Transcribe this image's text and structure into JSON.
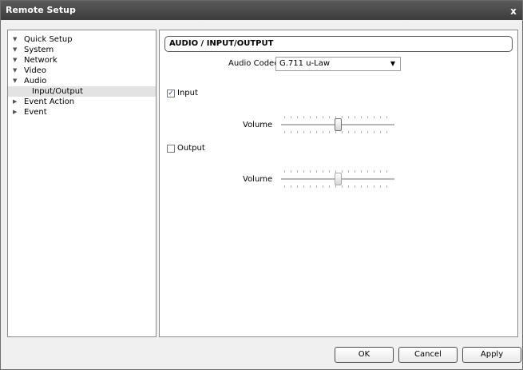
{
  "window": {
    "title": "Remote Setup",
    "close_glyph": "x",
    "close_icon": "close-icon"
  },
  "tree": {
    "items": [
      {
        "label": "Quick Setup",
        "expanded": true
      },
      {
        "label": "System",
        "expanded": true
      },
      {
        "label": "Network",
        "expanded": true
      },
      {
        "label": "Video",
        "expanded": true
      },
      {
        "label": "Audio",
        "expanded": true
      },
      {
        "label": "Input/Output",
        "selected": true
      },
      {
        "label": "Event Action",
        "expanded": false
      },
      {
        "label": "Event",
        "expanded": false
      }
    ],
    "expanded_glyph": "▼",
    "collapsed_glyph": "▶"
  },
  "panel": {
    "header": "AUDIO / INPUT/OUTPUT",
    "codec_label": "Audio Codec",
    "codec_value": "G.711 u-Law",
    "input": {
      "label": "Input",
      "checked": true,
      "volume_label": "Volume",
      "volume_level": 0.5
    },
    "output": {
      "label": "Output",
      "checked": false,
      "volume_label": "Volume",
      "volume_level": 0.5
    }
  },
  "buttons": {
    "ok": "OK",
    "cancel": "Cancel",
    "apply": "Apply"
  },
  "colors": {
    "titlebar": "#4a4a4a",
    "selected_row": "#e3e3e3",
    "checkmark": "#1a4c8f"
  }
}
